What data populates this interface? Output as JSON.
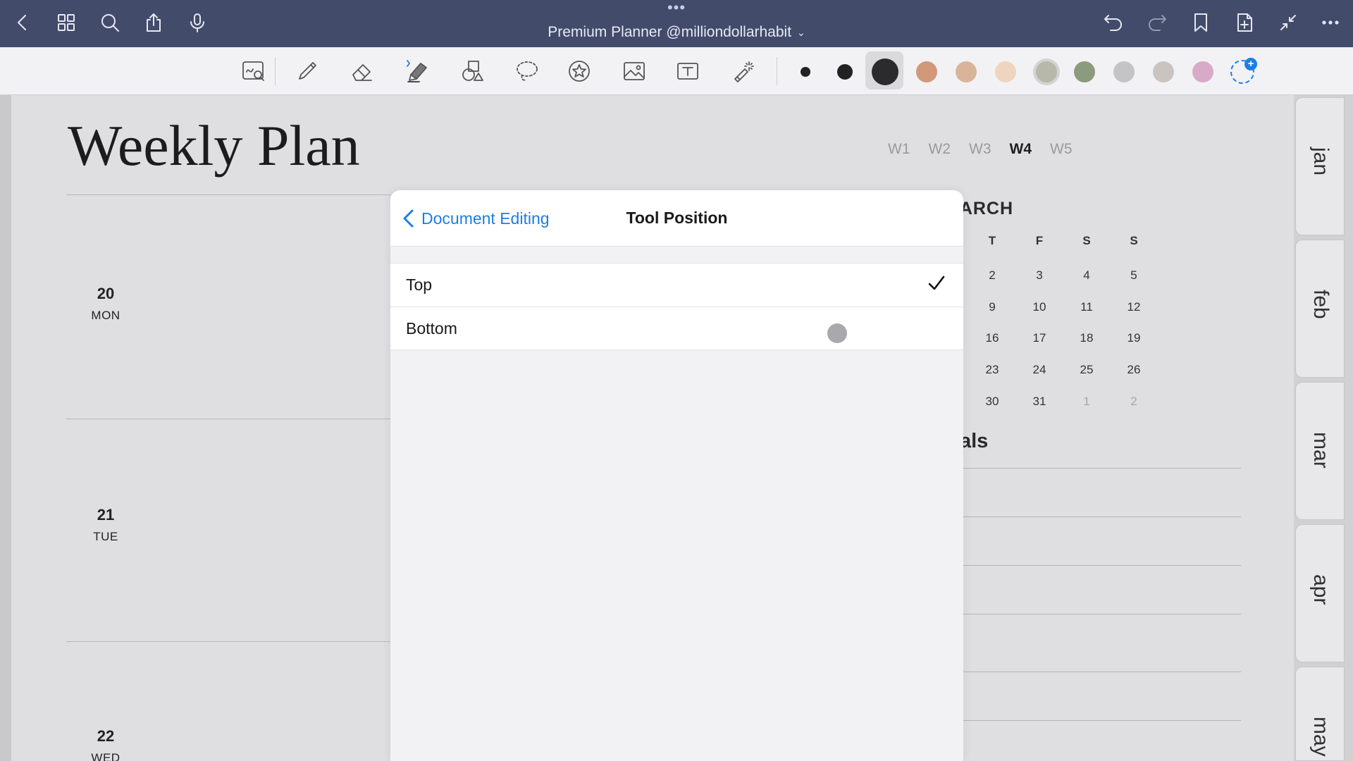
{
  "topbar": {
    "document_title": "Premium Planner @milliondollarhabit",
    "more_dots": "•••"
  },
  "toolbar": {
    "tools": [
      {
        "name": "zoom-writing-tool-icon"
      },
      {
        "name": "pen-tool-icon"
      },
      {
        "name": "eraser-tool-icon"
      },
      {
        "name": "highlighter-tool-icon"
      },
      {
        "name": "shapes-tool-icon"
      },
      {
        "name": "lasso-tool-icon"
      },
      {
        "name": "elements-sticker-tool-icon"
      },
      {
        "name": "image-tool-icon"
      },
      {
        "name": "text-tool-icon"
      },
      {
        "name": "laser-pointer-tool-icon"
      }
    ],
    "pen_sizes": [
      "small",
      "medium",
      "large"
    ],
    "colors": [
      "#d1987a",
      "#d8b59a",
      "#efd4bf",
      "#b7b8a8",
      "#8c9a7e",
      "#c4c3c6",
      "#c9c4c0",
      "#d9a9c8"
    ]
  },
  "planner": {
    "title": "Weekly Plan",
    "weeks": [
      {
        "label": "W1",
        "active": false
      },
      {
        "label": "W2",
        "active": false
      },
      {
        "label": "W3",
        "active": false
      },
      {
        "label": "W4",
        "active": true
      },
      {
        "label": "W5",
        "active": false
      }
    ],
    "days": [
      {
        "num": "20",
        "dow": "MON"
      },
      {
        "num": "21",
        "dow": "TUE"
      },
      {
        "num": "22",
        "dow": "WED"
      }
    ],
    "calendar": {
      "month": "MARCH",
      "headers": [
        "T",
        "F",
        "S",
        "S"
      ],
      "rows": [
        [
          "2",
          "3",
          "4",
          "5"
        ],
        [
          "9",
          "10",
          "11",
          "12"
        ],
        [
          "16",
          "17",
          "18",
          "19"
        ],
        [
          "23",
          "24",
          "25",
          "26"
        ],
        [
          "30",
          "31",
          "1",
          "2"
        ]
      ]
    },
    "goals_partial": "als",
    "month_tabs": [
      "jan",
      "feb",
      "mar",
      "apr",
      "may"
    ]
  },
  "modal": {
    "back_label": "Document Editing",
    "title": "Tool Position",
    "options": [
      {
        "label": "Top",
        "selected": true
      },
      {
        "label": "Bottom",
        "selected": false
      }
    ]
  }
}
